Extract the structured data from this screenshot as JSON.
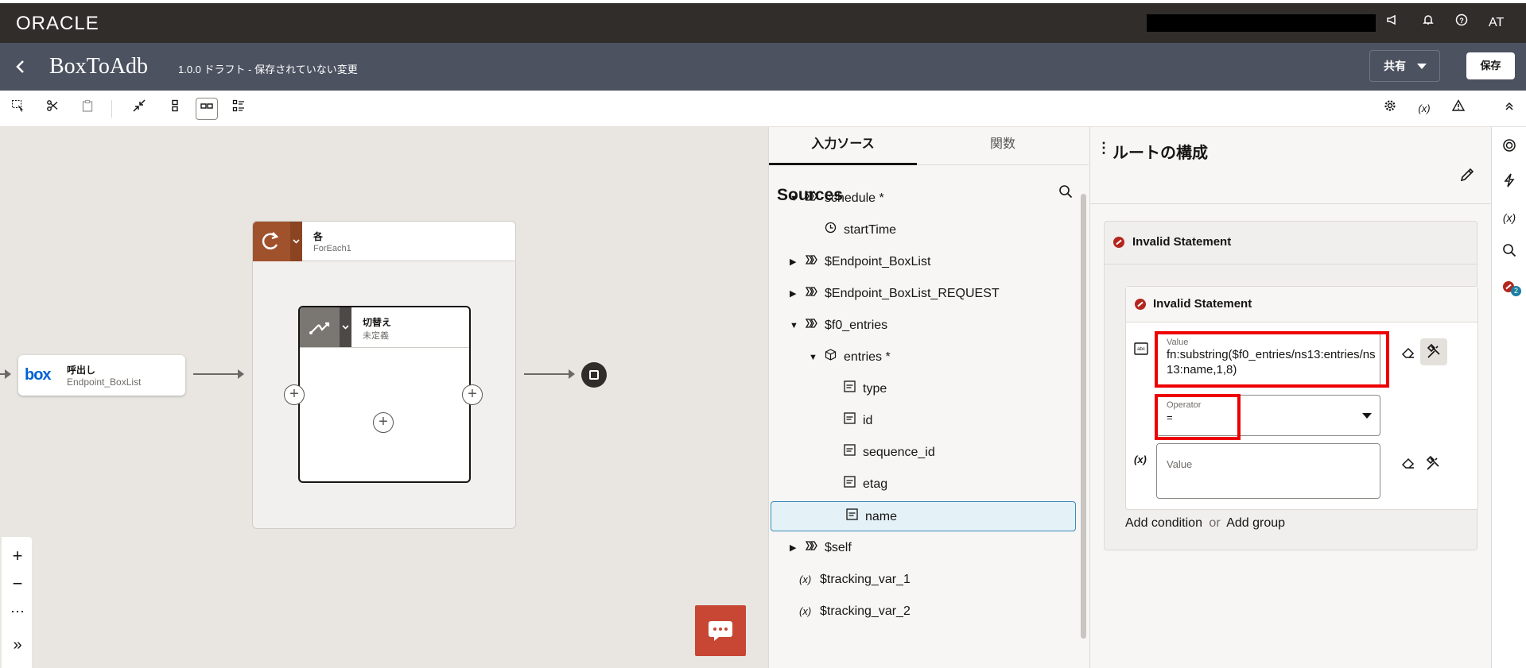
{
  "topbar": {
    "logo": "ORACLE",
    "avatar": "AT",
    "icons": [
      "megaphone-icon",
      "bell-icon",
      "help-icon"
    ]
  },
  "titlebar": {
    "title": "BoxToAdb",
    "version_status": "1.0.0 ドラフト - 保存されていない変更",
    "share_label": "共有",
    "save_label": "保存"
  },
  "canvas": {
    "invoke_node": {
      "logo": "box",
      "title": "呼出し",
      "subtitle": "Endpoint_BoxList"
    },
    "foreach_node": {
      "title": "各",
      "subtitle": "ForEach1"
    },
    "switch_node": {
      "title": "切替え",
      "subtitle": "未定義"
    }
  },
  "sources_panel": {
    "tabs": [
      "入力ソース",
      "関数"
    ],
    "title": "Sources",
    "tree": [
      {
        "label": "schedule *",
        "icon": "object-icon",
        "expanded": true
      },
      {
        "label": "startTime",
        "icon": "clock-icon"
      },
      {
        "label": "$Endpoint_BoxList",
        "icon": "object-icon",
        "expanded": false
      },
      {
        "label": "$Endpoint_BoxList_REQUEST",
        "icon": "object-icon",
        "expanded": false
      },
      {
        "label": "$f0_entries",
        "icon": "object-icon",
        "expanded": true
      },
      {
        "label": "entries *",
        "icon": "cube-icon",
        "expanded": true
      },
      {
        "label": "type",
        "icon": "string-icon"
      },
      {
        "label": "id",
        "icon": "string-icon"
      },
      {
        "label": "sequence_id",
        "icon": "string-icon"
      },
      {
        "label": "etag",
        "icon": "string-icon"
      },
      {
        "label": "name",
        "icon": "string-icon",
        "selected": true
      },
      {
        "label": "$self",
        "icon": "object-icon",
        "expanded": false
      },
      {
        "label": "$tracking_var_1",
        "icon": "variable-icon"
      },
      {
        "label": "$tracking_var_2",
        "icon": "variable-icon"
      }
    ]
  },
  "route_panel": {
    "title": "ルートの構成",
    "outer_error": "Invalid Statement",
    "inner_error": "Invalid Statement",
    "value_label": "Value",
    "value_text": "fn:substring($f0_entries/ns13:entries/ns13:name,1,8)",
    "operator_label": "Operator",
    "operator_value": "=",
    "value2_placeholder": "Value",
    "add_condition": "Add condition",
    "or_text": "or",
    "add_group": "Add group"
  },
  "right_rail": {
    "error_count": "2"
  },
  "colors": {
    "topbar": "#312d2a",
    "titlebar": "#4c5260",
    "foreach_accent": "#a0522d",
    "switch_accent": "#7a7672",
    "error": "#b3261e",
    "chat": "#c74634",
    "highlight": "#ee0000"
  }
}
